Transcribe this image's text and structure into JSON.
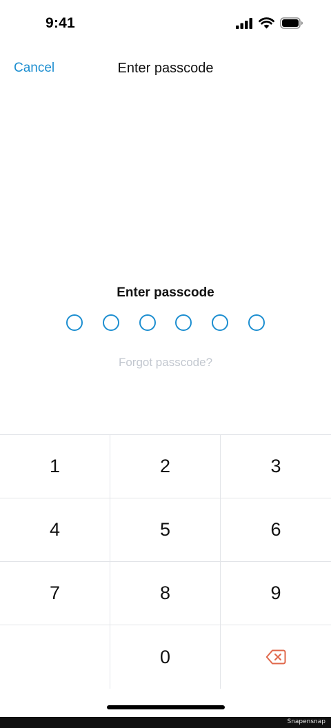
{
  "status_bar": {
    "time": "9:41",
    "icons": [
      "cellular-signal-icon",
      "wifi-icon",
      "battery-icon"
    ]
  },
  "nav": {
    "cancel_label": "Cancel",
    "title": "Enter passcode"
  },
  "passcode": {
    "prompt": "Enter passcode",
    "length": 6,
    "filled": 0,
    "forgot_label": "Forgot passcode?"
  },
  "keypad": {
    "keys": [
      "1",
      "2",
      "3",
      "4",
      "5",
      "6",
      "7",
      "8",
      "9",
      "",
      "0",
      "backspace-icon"
    ]
  },
  "watermark": "Snapensnap",
  "colors": {
    "accent": "#1c8ed0",
    "delete": "#e0674a",
    "disabled_text": "#c2c7cf",
    "divider": "#e2e4e8"
  }
}
